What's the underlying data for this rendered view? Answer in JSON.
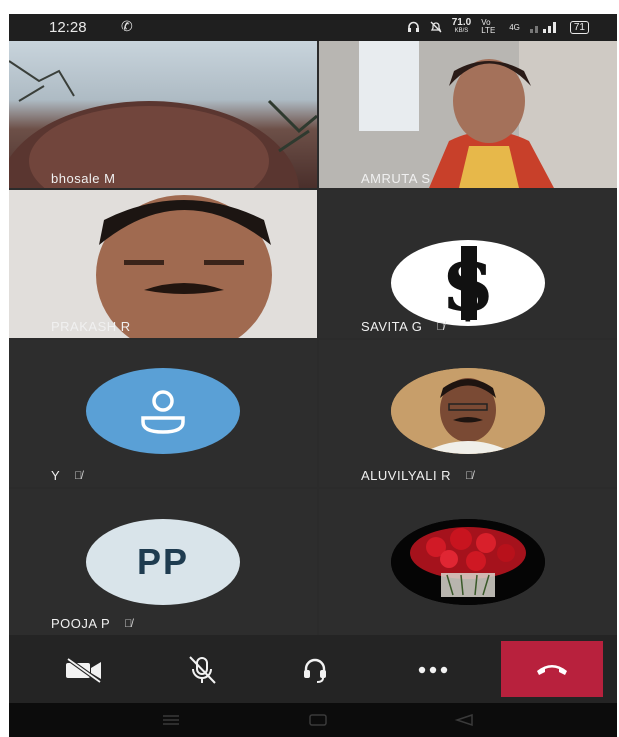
{
  "status_bar": {
    "time": "12:28",
    "call_glyph": "✆",
    "icons": [
      "headphones-icon",
      "mute-bell-icon",
      "data-speed-icon",
      "volte-icon",
      "signal-icon",
      "battery-icon"
    ],
    "speed": "71.0",
    "speed_unit": "KB/S",
    "network": "Vo LTE",
    "gen": "4G",
    "battery": "71"
  },
  "participants": [
    {
      "name": "bhosale M",
      "muted": false,
      "kind": "video"
    },
    {
      "name": "AMRUTA S",
      "muted": false,
      "kind": "video"
    },
    {
      "name": "PRAKASH R",
      "muted": false,
      "kind": "video"
    },
    {
      "name": "SAVITA G",
      "muted": true,
      "kind": "logo"
    },
    {
      "name": "Y",
      "muted": true,
      "kind": "default-avatar"
    },
    {
      "name": "ALUVILYALI R",
      "muted": true,
      "kind": "photo"
    },
    {
      "name": "POOJA P",
      "muted": true,
      "kind": "initials",
      "initials": "PP"
    },
    {
      "name": "",
      "muted": false,
      "kind": "flowers"
    }
  ],
  "controls": [
    "camera-off-icon",
    "mic-off-icon",
    "headset-icon",
    "more-icon",
    "end-call-icon"
  ],
  "colors": {
    "end_call": "#b8213d",
    "default_avatar": "#5aa0d6",
    "initials_avatar": "#d9e4ea",
    "initials_text": "#1f3c50"
  }
}
